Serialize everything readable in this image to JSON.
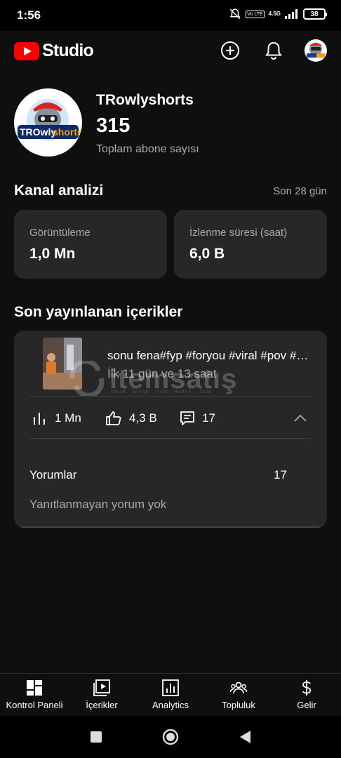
{
  "status_bar": {
    "time": "1:56",
    "network": "4.5G",
    "volte": "Vo LTE",
    "battery": "38"
  },
  "header": {
    "brand": "Studio",
    "icons": [
      "create-icon",
      "bell-icon",
      "account-avatar"
    ]
  },
  "channel": {
    "name": "TRowlyshorts",
    "subscriber_count": "315",
    "subscriber_label": "Toplam abone sayısı",
    "avatar_text": {
      "a": "TROwly",
      "b": "shorts"
    }
  },
  "analytics": {
    "title": "Kanal analizi",
    "period": "Son 28 gün",
    "cards": [
      {
        "label": "Görüntüleme",
        "value": "1,0 Mn"
      },
      {
        "label": "İzlenme süresi (saat)",
        "value": "6,0 B"
      }
    ]
  },
  "recent": {
    "title": "Son yayınlanan içerikler",
    "video": {
      "title": "sonu fena#fyp #foryou #viral #pov #trend",
      "age": "İlk 11 gün ve 13 saat",
      "views": "1 Mn",
      "likes": "4,3 B",
      "comments": "17"
    },
    "comments_section": {
      "label": "Yorumlar",
      "count": "17",
      "status": "Yanıtlanmayan yorum yok"
    }
  },
  "watermark": {
    "text": "itemsatış",
    "sub": "OYUN · DEFNE · ITEM · HESAP · .COM"
  },
  "bottom_nav": [
    {
      "label": "Kontrol Paneli",
      "icon": "dashboard-icon"
    },
    {
      "label": "İçerikler",
      "icon": "content-icon"
    },
    {
      "label": "Analytics",
      "icon": "analytics-icon"
    },
    {
      "label": "Topluluk",
      "icon": "community-icon"
    },
    {
      "label": "Gelir",
      "icon": "earn-icon"
    }
  ],
  "colors": {
    "background": "#0f0f0f",
    "card": "#272727",
    "brand_red": "#ff0000",
    "secondary_text": "#aaaaaa"
  }
}
